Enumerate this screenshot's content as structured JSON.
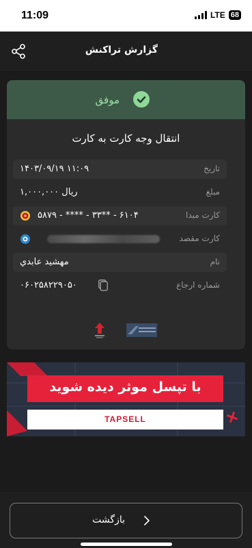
{
  "status_bar": {
    "time": "11:09",
    "network": "LTE",
    "battery": "68"
  },
  "header": {
    "title": "گزارش تراکنش",
    "share_icon": "share-icon"
  },
  "receipt": {
    "status": "موفق",
    "status_icon": "check-circle-icon",
    "title": "انتقال وجه کارت به کارت",
    "rows": [
      {
        "label": "تاریخ",
        "value": "۱۴۰۳/۰۹/۱۹ ۱۱:۰۹"
      },
      {
        "label": "مبلغ",
        "value": "۱,۰۰۰,۰۰۰ ریال"
      },
      {
        "label": "کارت مبدا",
        "value": "۵۸۷۹ - **** - ۳۳** - ۶۱۰۴",
        "icon": "bank-logo-icon"
      },
      {
        "label": "کارت مقصد",
        "value": "",
        "icon": "bank-logo-icon",
        "masked": true
      },
      {
        "label": "نام",
        "value": "مهشید عابدي"
      },
      {
        "label": "شماره ارجاع",
        "value": "۰۶۰۲۵۸۲۲۹۰۵۰",
        "icon": "copy-icon"
      }
    ]
  },
  "ad": {
    "headline": "با تپسل موثر دیده شوید",
    "brand": "TAPSELL",
    "close_icon": "close-icon"
  },
  "footer": {
    "back_label": "بازگشت",
    "back_icon": "chevron-right-icon"
  },
  "colors": {
    "success": "#8fd899",
    "success_band": "#3d5a48",
    "ad_red": "#e6223b",
    "background": "#1b1b1b",
    "card": "#2b2b2b"
  }
}
